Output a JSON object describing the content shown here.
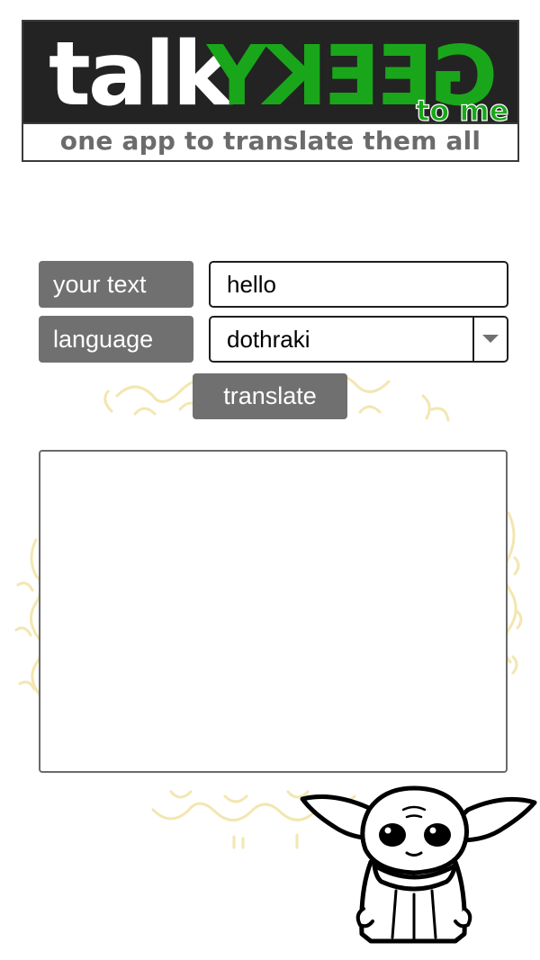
{
  "logo": {
    "word_talk": "talk",
    "word_geeky": "GEEKY",
    "word_tome": "to me",
    "tagline": "one app to translate them all"
  },
  "form": {
    "text_label": "your text",
    "text_value": "hello",
    "language_label": "language",
    "language_selected": "dothraki",
    "translate_label": "translate"
  },
  "output": {
    "value": ""
  },
  "colors": {
    "brand_green": "#1aa61a",
    "dark": "#232323",
    "label_gray": "#707070",
    "ring_gold": "#f3e6b0"
  },
  "icons": [
    "dropdown-arrow-icon",
    "elvish-ring-decoration",
    "baby-yoda-mascot"
  ]
}
